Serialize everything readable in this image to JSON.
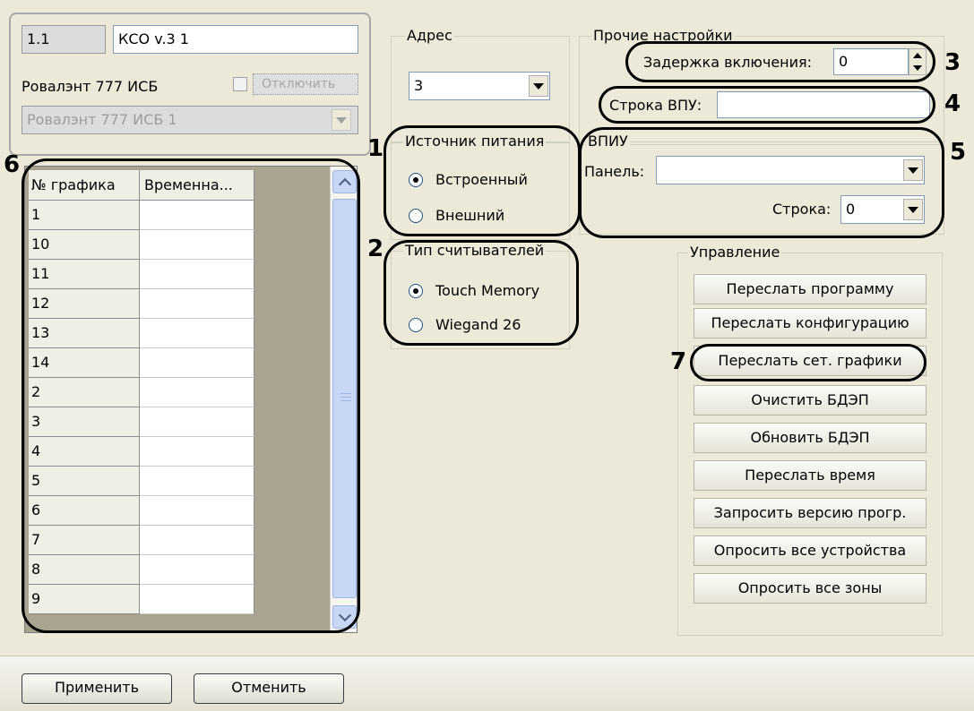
{
  "device": {
    "id_value": "1.1",
    "name_value": "КСО v.3 1",
    "title": "Ровалэнт 777 ИСБ",
    "disable_label": "Отключить",
    "selected_device": "Ровалэнт 777 ИСБ 1"
  },
  "address": {
    "title": "Адрес",
    "value": "3"
  },
  "other_settings": {
    "title": "Прочие настройки",
    "delay_label": "Задержка включения:",
    "delay_value": "0",
    "vpu_label": "Строка ВПУ:",
    "vpu_value": ""
  },
  "power_source": {
    "title": "Источник питания",
    "options": [
      "Встроенный",
      "Внешний"
    ],
    "selected": "Встроенный"
  },
  "reader_type": {
    "title": "Тип считывателей",
    "options": [
      "Touch Memory",
      "Wiegand 26"
    ],
    "selected": "Touch Memory"
  },
  "vpiu": {
    "title": "ВПИУ",
    "panel_label": "Панель:",
    "panel_value": "",
    "row_label": "Строка:",
    "row_value": "0"
  },
  "schedule_table": {
    "columns": [
      "№ графика",
      "Временна..."
    ],
    "rows": [
      "1",
      "10",
      "11",
      "12",
      "13",
      "14",
      "2",
      "3",
      "4",
      "5",
      "6",
      "7",
      "8",
      "9"
    ]
  },
  "control": {
    "title": "Управление",
    "buttons": [
      "Переслать программу",
      "Переслать конфигурацию",
      "Переслать сет. графики",
      "Очистить БДЭП",
      "Обновить БДЭП",
      "Переслать время",
      "Запросить версию прогр.",
      "Опросить все устройства",
      "Опросить все зоны"
    ]
  },
  "annotations": [
    "1",
    "2",
    "3",
    "4",
    "5",
    "6",
    "7"
  ],
  "footer": {
    "apply_label": "Применить",
    "cancel_label": "Отменить"
  }
}
